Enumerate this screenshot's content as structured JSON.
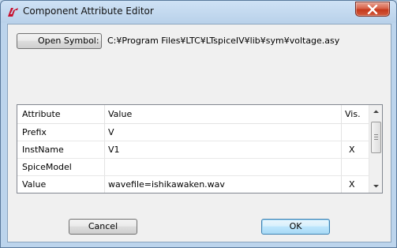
{
  "window": {
    "title": "Component Attribute Editor"
  },
  "toolbar": {
    "open_symbol_label": "Open Symbol:",
    "symbol_path": "C:¥Program Files¥LTC¥LTspiceIV¥lib¥sym¥voltage.asy"
  },
  "table": {
    "headers": {
      "attribute": "Attribute",
      "value": "Value",
      "vis": "Vis."
    },
    "rows": [
      {
        "attribute": "Prefix",
        "value": "V",
        "vis": ""
      },
      {
        "attribute": "InstName",
        "value": "V1",
        "vis": "X"
      },
      {
        "attribute": "SpiceModel",
        "value": "",
        "vis": ""
      },
      {
        "attribute": "Value",
        "value": "wavefile=ishikawaken.wav",
        "vis": "X"
      }
    ]
  },
  "footer": {
    "cancel_label": "Cancel",
    "ok_label": "OK"
  },
  "colors": {
    "title_bar": "#b9d1ea",
    "close_button": "#c5391c",
    "dialog_bg": "#f0f0f0",
    "default_button_border": "#3c7fb1"
  },
  "icons": {
    "app": "ltspice-logo-icon",
    "close": "close-icon",
    "scroll_up": "scroll-up-arrow-icon",
    "scroll_down": "scroll-down-arrow-icon"
  }
}
